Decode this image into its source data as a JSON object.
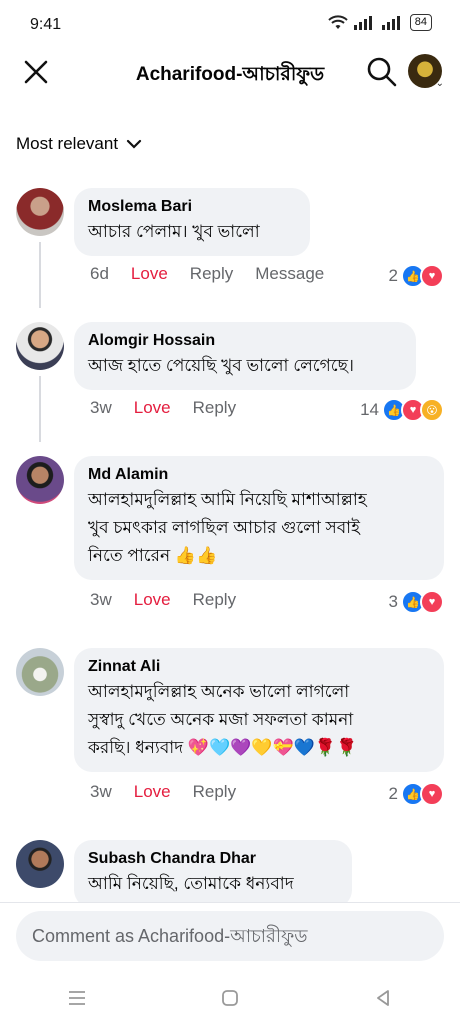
{
  "status": {
    "time": "9:41",
    "battery": "84"
  },
  "header": {
    "title": "Acharifood-আচারীফুড"
  },
  "sort": {
    "label": "Most relevant"
  },
  "comments": [
    {
      "author": "Moslema Bari",
      "text": [
        "আচার পেলাম। খুব ভালো"
      ],
      "time": "6d",
      "love": "Love",
      "reply": "Reply",
      "message": "Message",
      "count": "2"
    },
    {
      "author": "Alomgir Hossain",
      "text": [
        "আজ হাতে পেয়েছি খুব ভালো লেগেছে।"
      ],
      "time": "3w",
      "love": "Love",
      "reply": "Reply",
      "count": "14"
    },
    {
      "author": "Md Alamin",
      "text": [
        "আলহামদুলিল্লাহ আমি নিয়েছি মাশাআল্লাহ",
        "খুব চমৎকার লাগছিল আচার গুলো সবাই",
        "নিতে পারেন 👍👍"
      ],
      "time": "3w",
      "love": "Love",
      "reply": "Reply",
      "count": "3"
    },
    {
      "author": "Zinnat Ali",
      "text": [
        "আলহামদুলিল্লাহ অনেক ভালো লাগলো",
        "সুস্বাদু খেতে অনেক মজা সফলতা কামনা",
        "করছি। ধন্যবাদ 💖🩵💜💛💝💙🌹🌹"
      ],
      "time": "3w",
      "love": "Love",
      "reply": "Reply",
      "count": "2"
    },
    {
      "author": "Subash Chandra Dhar",
      "text": [
        "আমি নিয়েছি, তোমাকে ধন্যবাদ"
      ]
    }
  ],
  "composer": {
    "placeholder": "Comment as Acharifood-আচারীফুড"
  },
  "colors": {
    "accent": "#1877f2",
    "love": "#e41e3f",
    "bubble": "#f0f2f5"
  }
}
